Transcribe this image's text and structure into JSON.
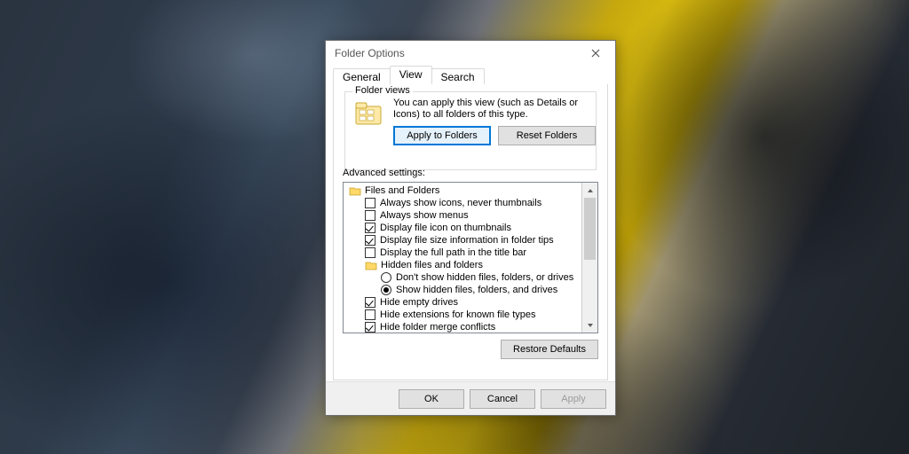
{
  "dialog": {
    "title": "Folder Options",
    "tabs": {
      "general": "General",
      "view": "View",
      "search": "Search"
    },
    "folderViews": {
      "legend": "Folder views",
      "text": "You can apply this view (such as Details or Icons) to all folders of this type.",
      "applyBtn": "Apply to Folders",
      "resetBtn": "Reset Folders"
    },
    "advanced": {
      "label": "Advanced settings:",
      "rootLabel": "Files and Folders",
      "items": [
        {
          "kind": "check",
          "checked": false,
          "label": "Always show icons, never thumbnails"
        },
        {
          "kind": "check",
          "checked": false,
          "label": "Always show menus"
        },
        {
          "kind": "check",
          "checked": true,
          "label": "Display file icon on thumbnails"
        },
        {
          "kind": "check",
          "checked": true,
          "label": "Display file size information in folder tips"
        },
        {
          "kind": "check",
          "checked": false,
          "label": "Display the full path in the title bar"
        },
        {
          "kind": "folder",
          "label": "Hidden files and folders"
        },
        {
          "kind": "radio",
          "checked": false,
          "label": "Don't show hidden files, folders, or drives",
          "indent": 3
        },
        {
          "kind": "radio",
          "checked": true,
          "label": "Show hidden files, folders, and drives",
          "indent": 3
        },
        {
          "kind": "check",
          "checked": true,
          "label": "Hide empty drives"
        },
        {
          "kind": "check",
          "checked": false,
          "label": "Hide extensions for known file types"
        },
        {
          "kind": "check",
          "checked": true,
          "label": "Hide folder merge conflicts"
        }
      ],
      "restoreBtn": "Restore Defaults"
    },
    "buttons": {
      "ok": "OK",
      "cancel": "Cancel",
      "apply": "Apply"
    }
  }
}
